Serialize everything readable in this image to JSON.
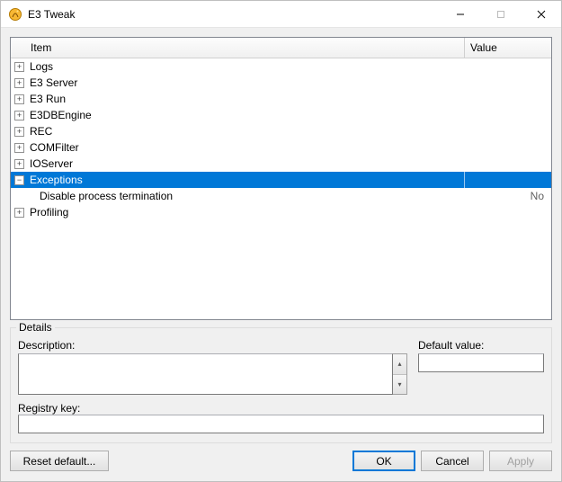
{
  "window": {
    "title": "E3 Tweak",
    "icon": "app-icon"
  },
  "grid": {
    "columns": {
      "item": "Item",
      "value": "Value"
    },
    "rows": [
      {
        "type": "group",
        "expanded": false,
        "label": "Logs",
        "value": ""
      },
      {
        "type": "group",
        "expanded": false,
        "label": "E3 Server",
        "value": ""
      },
      {
        "type": "group",
        "expanded": false,
        "label": "E3 Run",
        "value": ""
      },
      {
        "type": "group",
        "expanded": false,
        "label": "E3DBEngine",
        "value": ""
      },
      {
        "type": "group",
        "expanded": false,
        "label": "REC",
        "value": ""
      },
      {
        "type": "group",
        "expanded": false,
        "label": "COMFilter",
        "value": ""
      },
      {
        "type": "group",
        "expanded": false,
        "label": "IOServer",
        "value": ""
      },
      {
        "type": "group",
        "expanded": true,
        "label": "Exceptions",
        "value": "",
        "selected": true
      },
      {
        "type": "child",
        "label": "Disable process termination",
        "value": "No"
      },
      {
        "type": "group",
        "expanded": false,
        "label": "Profiling",
        "value": ""
      }
    ]
  },
  "details": {
    "legend": "Details",
    "description_label": "Description:",
    "description_value": "",
    "default_label": "Default value:",
    "default_value": "",
    "regkey_label": "Registry key:",
    "regkey_value": ""
  },
  "buttons": {
    "reset": "Reset default...",
    "ok": "OK",
    "cancel": "Cancel",
    "apply": "Apply"
  }
}
